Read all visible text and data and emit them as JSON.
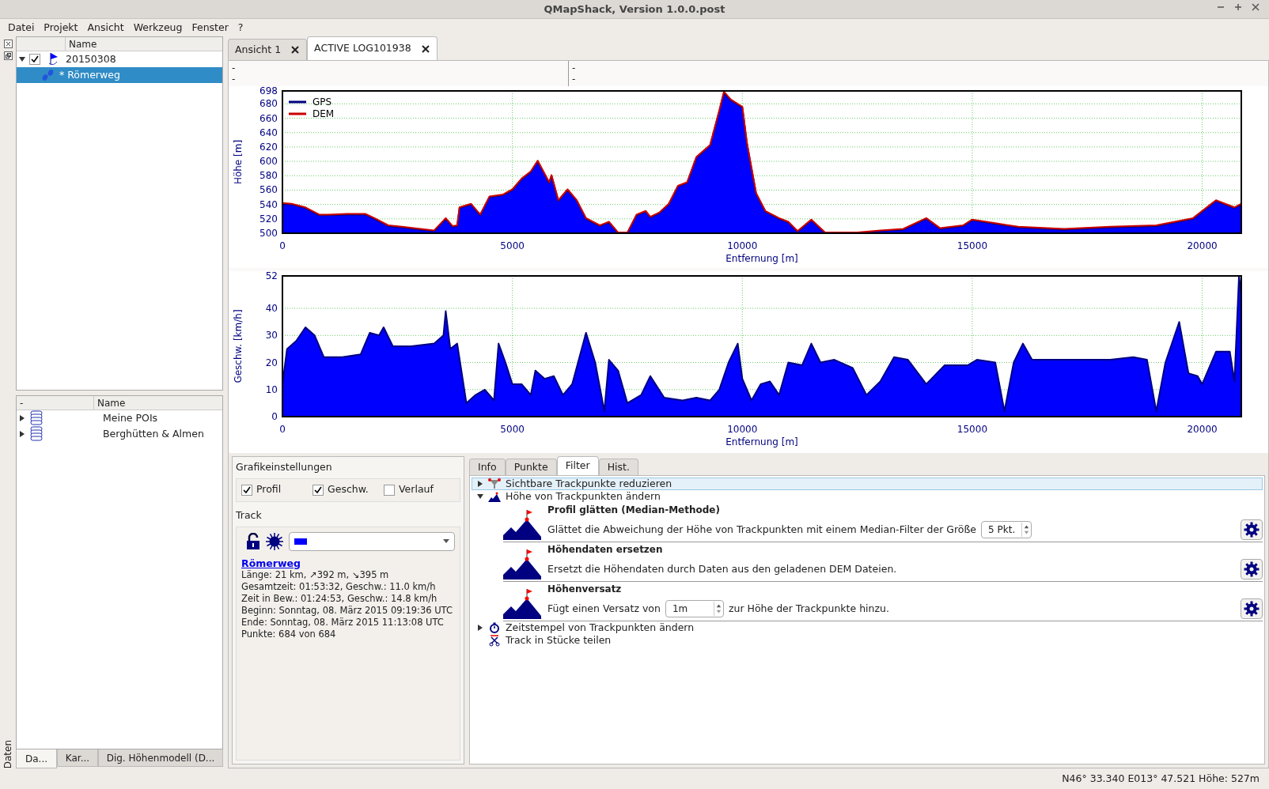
{
  "window": {
    "title": "QMapShack, Version 1.0.0.post"
  },
  "menu": [
    "Datei",
    "Projekt",
    "Ansicht",
    "Werkzeug",
    "Fenster",
    "?"
  ],
  "dock": {
    "title": "Daten",
    "workspace": {
      "columns": [
        "Name"
      ],
      "items": [
        {
          "name": "20150308",
          "expanded": true,
          "checked": true,
          "children": [
            {
              "name": "* Römerweg",
              "selected": true
            }
          ]
        }
      ]
    },
    "databases": {
      "columns": [
        "-",
        "Name"
      ],
      "items": [
        {
          "name": "Meine POIs",
          "expanded": false
        },
        {
          "name": "Berghütten & Almen",
          "expanded": false
        }
      ]
    },
    "tabs": [
      {
        "label": "Da...",
        "selected": true
      },
      {
        "label": "Kar...",
        "selected": false
      },
      {
        "label": "Dig. Höhenmodell (D...",
        "selected": false
      }
    ]
  },
  "doc_tabs": [
    {
      "label": "Ansicht 1",
      "selected": false
    },
    {
      "label": "ACTIVE LOG101938",
      "selected": true
    }
  ],
  "info_strip": [
    [
      "-",
      "-"
    ],
    [
      "-",
      "-"
    ]
  ],
  "elevation_plot": {
    "chart_data": {
      "type": "area",
      "xlabel": "Entfernung [m]",
      "ylabel": "Höhe [m]",
      "x": [
        0,
        200,
        500,
        800,
        1000,
        1400,
        1800,
        2000,
        2300,
        2600,
        3000,
        3300,
        3550,
        3700,
        3800,
        3850,
        4100,
        4300,
        4500,
        4800,
        5000,
        5200,
        5400,
        5550,
        5800,
        5850,
        6000,
        6200,
        6400,
        6600,
        6900,
        7100,
        7300,
        7500,
        7700,
        7900,
        8000,
        8200,
        8400,
        8600,
        8800,
        9000,
        9300,
        9500,
        9600,
        9750,
        10000,
        10100,
        10300,
        10500,
        10800,
        11000,
        11200,
        11500,
        11800,
        12500,
        13000,
        13500,
        14000,
        14300,
        14800,
        15000,
        15500,
        16000,
        17000,
        18000,
        19000,
        19800,
        20300,
        20700,
        20850
      ],
      "series": [
        {
          "name": "GPS",
          "color": "#000080",
          "values": [
            540,
            540,
            535,
            525,
            525,
            526,
            526,
            520,
            510,
            508,
            505,
            503,
            520,
            509,
            510,
            535,
            540,
            525,
            550,
            553,
            560,
            575,
            585,
            600,
            570,
            580,
            545,
            560,
            545,
            520,
            510,
            515,
            500,
            500,
            525,
            530,
            522,
            528,
            540,
            565,
            570,
            605,
            622,
            670,
            695,
            685,
            675,
            625,
            555,
            530,
            520,
            515,
            502,
            518,
            500,
            500,
            503,
            505,
            520,
            506,
            510,
            518,
            513,
            508,
            505,
            508,
            510,
            520,
            545,
            535,
            540
          ]
        },
        {
          "name": "DEM",
          "type": "line",
          "color": "#cc0000",
          "values": [
            542,
            541,
            536,
            526,
            526,
            527,
            527,
            521,
            511,
            509,
            506,
            504,
            521,
            510,
            511,
            536,
            541,
            526,
            551,
            554,
            561,
            576,
            586,
            601,
            571,
            581,
            546,
            561,
            546,
            521,
            511,
            516,
            501,
            501,
            526,
            531,
            523,
            529,
            541,
            566,
            571,
            606,
            623,
            671,
            697,
            686,
            676,
            626,
            556,
            531,
            521,
            516,
            503,
            519,
            501,
            501,
            504,
            506,
            521,
            507,
            511,
            519,
            514,
            509,
            506,
            509,
            511,
            521,
            546,
            536,
            541
          ]
        }
      ],
      "grid": true,
      "legend": "upper left",
      "xlim": [
        0,
        20850
      ],
      "ylim": [
        500,
        698
      ],
      "xticks": [
        0,
        5000,
        10000,
        15000,
        20000
      ],
      "yticks": [
        500,
        520,
        540,
        560,
        580,
        600,
        620,
        640,
        660,
        680,
        698
      ]
    }
  },
  "speed_plot": {
    "chart_data": {
      "type": "area",
      "xlabel": "Entfernung [m]",
      "ylabel": "Geschw. [km/h]",
      "x": [
        0,
        100,
        300,
        500,
        700,
        900,
        1300,
        1700,
        1900,
        2100,
        2200,
        2400,
        2800,
        3300,
        3500,
        3550,
        3650,
        3800,
        3900,
        4000,
        4200,
        4400,
        4600,
        4700,
        4850,
        5000,
        5200,
        5400,
        5500,
        5700,
        5900,
        6100,
        6300,
        6600,
        6800,
        7000,
        7100,
        7300,
        7500,
        7800,
        8000,
        8300,
        8700,
        9000,
        9300,
        9500,
        9700,
        9900,
        10000,
        10200,
        10400,
        10600,
        10800,
        11000,
        11300,
        11500,
        11700,
        12000,
        12400,
        12700,
        13000,
        13300,
        13600,
        14000,
        14400,
        14900,
        15100,
        15500,
        15700,
        15900,
        16100,
        16300,
        17000,
        18000,
        18500,
        18800,
        19000,
        19200,
        19500,
        19700,
        19900,
        20000,
        20300,
        20600,
        20700,
        20800,
        20850
      ],
      "series": [
        {
          "color": "#000080",
          "values": [
            12,
            25,
            28,
            33,
            30,
            22,
            22,
            23,
            31,
            30,
            33,
            26,
            26,
            27,
            30,
            39,
            25,
            27,
            16,
            5,
            8,
            10,
            6,
            27,
            20,
            12,
            12,
            8,
            17,
            14,
            15,
            8,
            12,
            31,
            20,
            2,
            21,
            17,
            5,
            8,
            15,
            7,
            6,
            7,
            6,
            10,
            20,
            27,
            14,
            6,
            12,
            13,
            8,
            20,
            19,
            27,
            20,
            21,
            18,
            8,
            13,
            22,
            21,
            12,
            19,
            19,
            21,
            20,
            2,
            20,
            27,
            21,
            21,
            21,
            22,
            21,
            2,
            20,
            35,
            16,
            15,
            12,
            24,
            24,
            13,
            52,
            45
          ]
        }
      ],
      "grid": true,
      "xlim": [
        0,
        20850
      ],
      "ylim": [
        0,
        52
      ],
      "xticks": [
        0,
        5000,
        10000,
        15000,
        20000
      ],
      "yticks": [
        0,
        10,
        20,
        30,
        40,
        52
      ]
    }
  },
  "graphics_settings": {
    "title": "Grafikeinstellungen",
    "options": [
      {
        "label": "Profil",
        "checked": true
      },
      {
        "label": "Geschw.",
        "checked": true
      },
      {
        "label": "Verlauf",
        "checked": false
      }
    ]
  },
  "track": {
    "title": "Track",
    "color": "#0000ff",
    "name": "Römerweg",
    "details": [
      "Länge: 21 km, ↗392 m, ↘395 m",
      "Gesamtzeit: 01:53:32, Geschw.: 11.0 km/h",
      "Zeit in Bew.: 01:24:53, Geschw.: 14.8 km/h",
      "Beginn: Sonntag, 08. März 2015 09:19:36 UTC",
      "Ende: Sonntag, 08. März 2015 11:13:08 UTC",
      "Punkte: 684 von 684"
    ]
  },
  "edit_tabs": [
    {
      "label": "Info",
      "selected": false
    },
    {
      "label": "Punkte",
      "selected": false
    },
    {
      "label": "Filter",
      "selected": true
    },
    {
      "label": "Hist.",
      "selected": false
    }
  ],
  "filters": [
    {
      "kind": "reduce",
      "label": "Sichtbare Trackpunkte reduzieren",
      "expanded": false,
      "selected": true
    },
    {
      "kind": "elevation",
      "label": "Höhe von Trackpunkten ändern",
      "expanded": true,
      "selected": false,
      "children": [
        {
          "title": "Profil glätten (Median-Methode)",
          "text_before": "Glättet die Abweichung der Höhe von Trackpunkten mit einem Median-Filter der Größe",
          "spin": "5 Pkt."
        },
        {
          "title": "Höhendaten ersetzen",
          "text_before": "Ersetzt die Höhendaten durch Daten aus den geladenen DEM Dateien."
        },
        {
          "title": "Höhenversatz",
          "text_before": "Fügt einen Versatz von",
          "spin": "1m",
          "text_after": "zur Höhe der Trackpunkte hinzu."
        }
      ]
    },
    {
      "kind": "time",
      "label": "Zeitstempel von Trackpunkten ändern",
      "expanded": false,
      "selected": false
    },
    {
      "kind": "split",
      "label": "Track in Stücke teilen",
      "selected": false
    }
  ],
  "status_bar": "N46° 33.340 E013° 47.521 Höhe: 527m"
}
